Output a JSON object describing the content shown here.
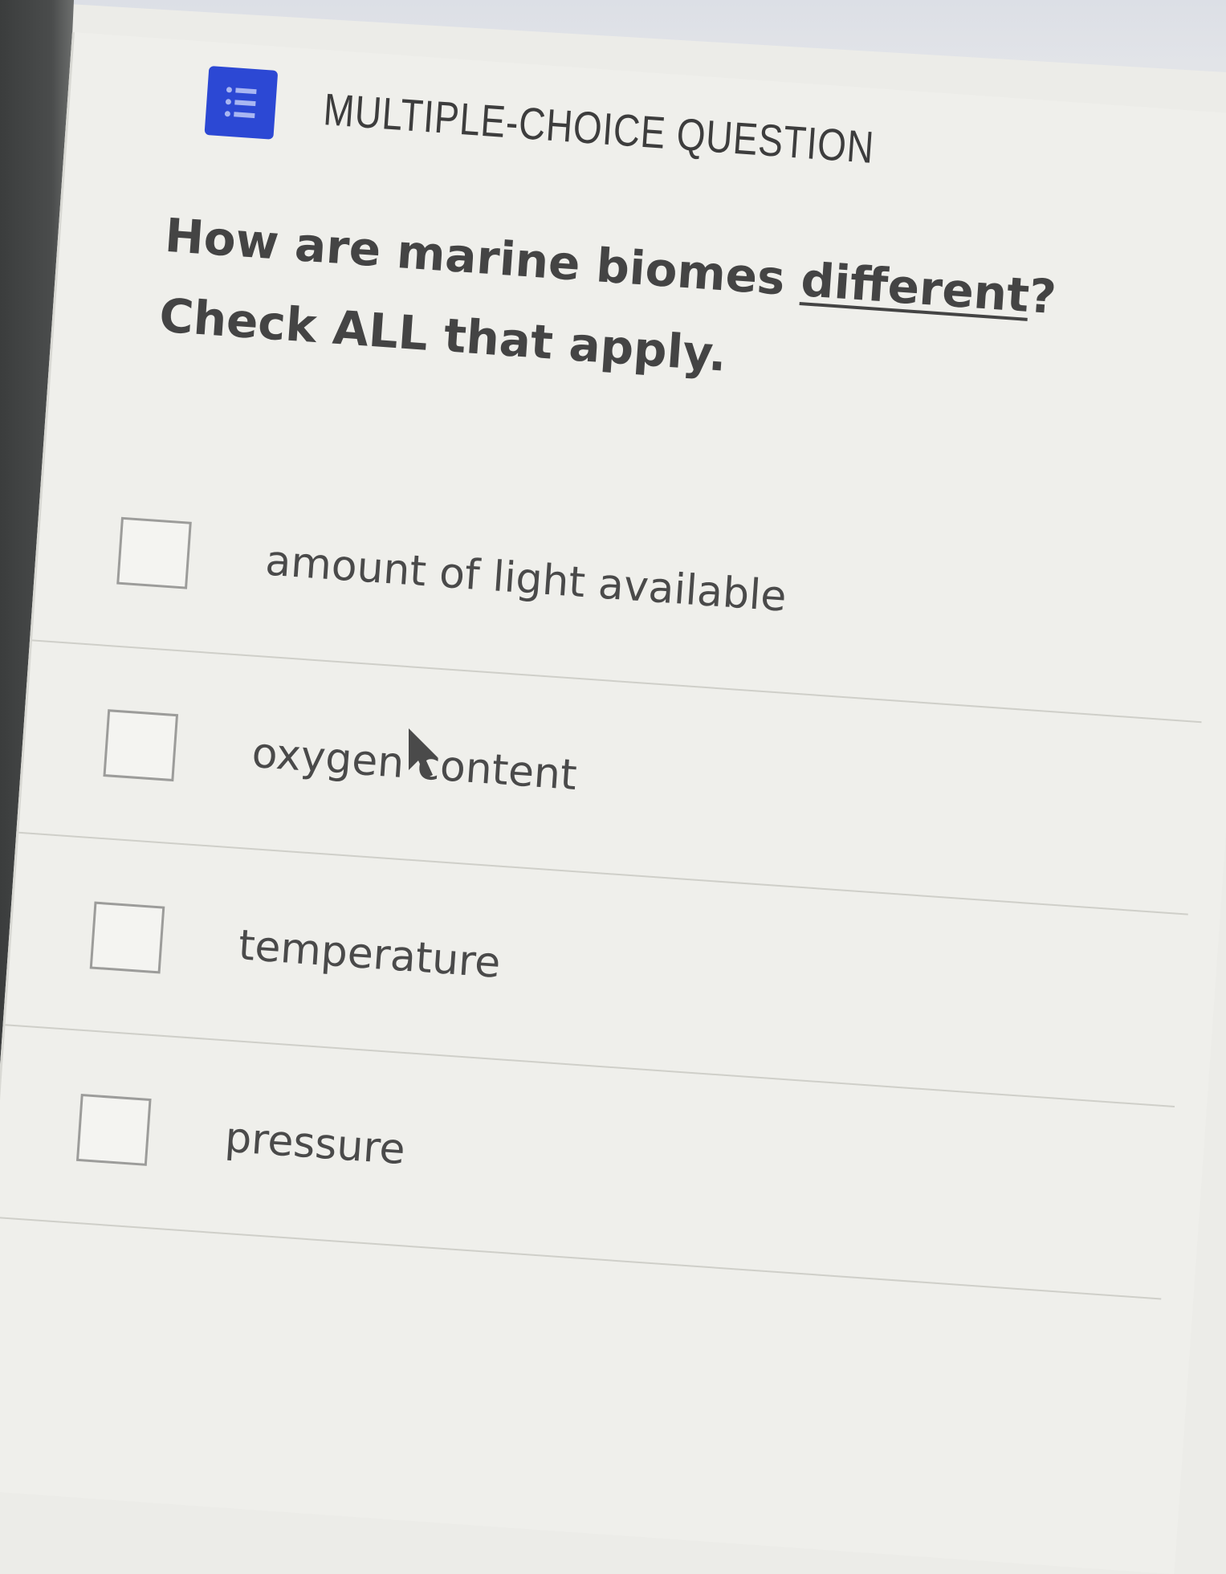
{
  "question": {
    "type_label": "MULTIPLE-CHOICE QUESTION",
    "type_icon": "list-icon",
    "prompt_before": "How are marine biomes ",
    "prompt_underlined": "different",
    "prompt_after": "?",
    "instruction": "Check ALL that apply."
  },
  "options": [
    {
      "label": "amount of light available",
      "checked": false
    },
    {
      "label": "oxygen content",
      "checked": false
    },
    {
      "label": "temperature",
      "checked": false
    },
    {
      "label": "pressure",
      "checked": false
    }
  ],
  "colors": {
    "accent": "#2c48d4",
    "text": "#444444",
    "background": "#efefeb"
  }
}
